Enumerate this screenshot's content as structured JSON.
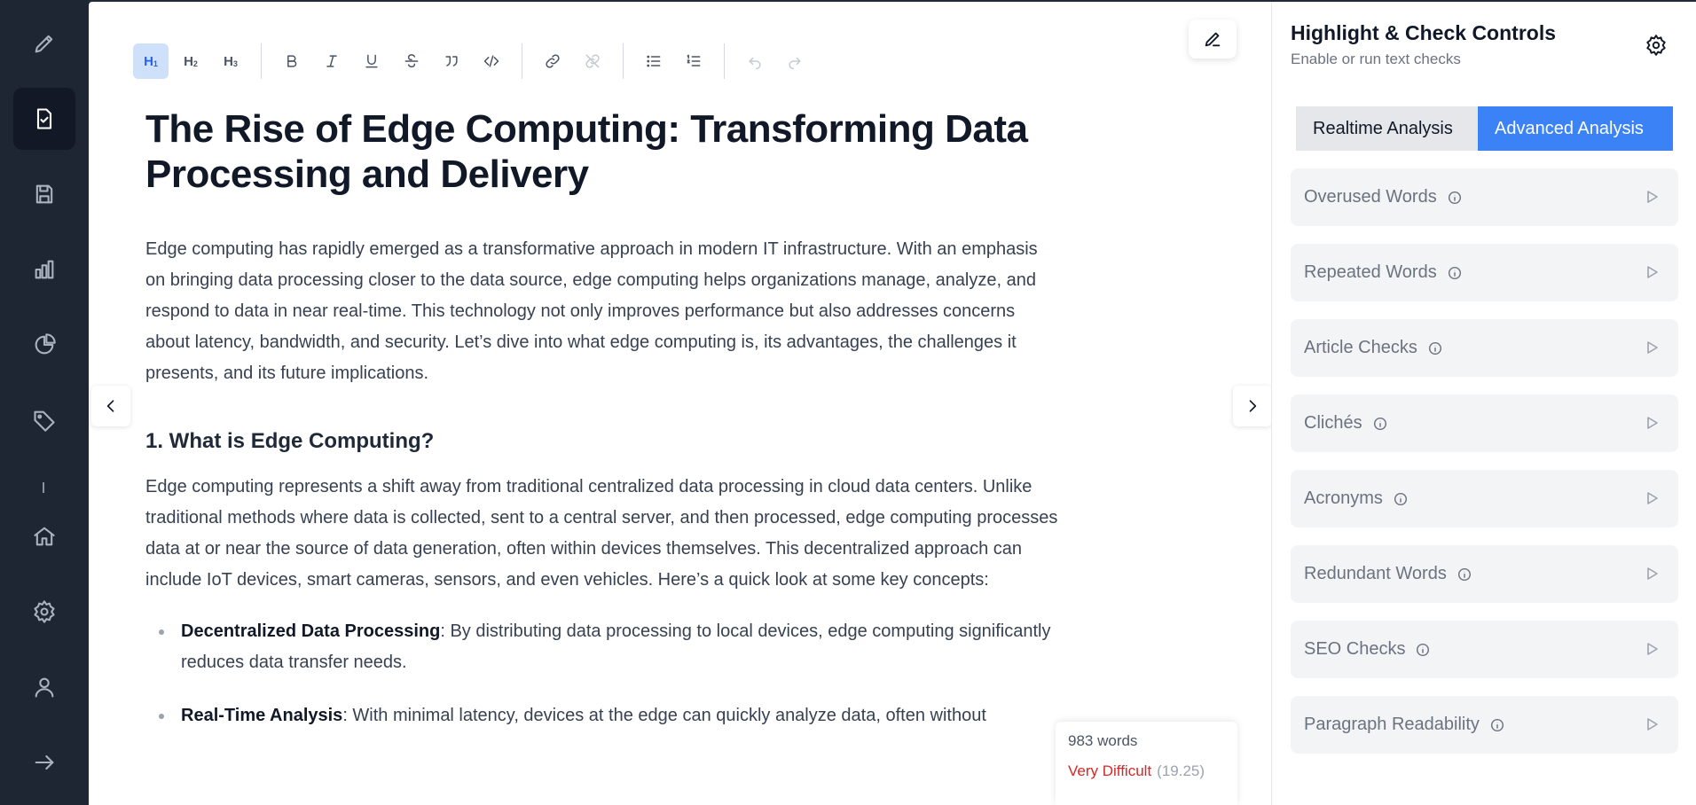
{
  "nav": {
    "items": [
      {
        "icon": "pencil-icon"
      },
      {
        "icon": "document-check-icon",
        "active": true
      },
      {
        "icon": "save-icon"
      },
      {
        "icon": "bar-chart-icon"
      },
      {
        "icon": "pie-chart-icon"
      },
      {
        "icon": "tag-icon"
      },
      {
        "icon": "home-icon"
      },
      {
        "icon": "gear-icon"
      },
      {
        "icon": "user-icon"
      },
      {
        "icon": "arrow-right-icon"
      }
    ]
  },
  "toolbar": {
    "h1": "H",
    "h1_sub": "1",
    "h2": "H",
    "h2_sub": "2",
    "h3": "H",
    "h3_sub": "3",
    "active_heading": "H1"
  },
  "document": {
    "title": "The Rise of Edge Computing: Transforming Data Processing and Delivery",
    "intro": "Edge computing has rapidly emerged as a transformative approach in modern IT infrastructure. With an emphasis on bringing data processing closer to the data source, edge computing helps organizations manage, analyze, and respond to data in near real-time. This technology not only improves performance but also addresses concerns about latency, bandwidth, and security. Let’s dive into what edge computing is, its advantages, the challenges it presents, and its future implications.",
    "section1_heading": "1. What is Edge Computing?",
    "section1_body": "Edge computing represents a shift away from traditional centralized data processing in cloud data centers. Unlike traditional methods where data is collected, sent to a central server, and then processed, edge computing processes data at or near the source of data generation, often within devices themselves. This decentralized approach can include IoT devices, smart cameras, sensors, and even vehicles. Here’s a quick look at some key concepts:",
    "bullets": [
      {
        "term": "Decentralized Data Processing",
        "text": ": By distributing data processing to local devices, edge computing significantly reduces data transfer needs."
      },
      {
        "term": "Real-Time Analysis",
        "text": ": With minimal latency, devices at the edge can quickly analyze data, often without"
      }
    ]
  },
  "stats": {
    "word_count": "983 words",
    "difficulty": "Very Difficult",
    "score": "(19.25)",
    "difficulty_color": "#dc2626"
  },
  "panel": {
    "title": "Highlight & Check Controls",
    "subtitle": "Enable or run text checks",
    "tabs": [
      {
        "label": "Realtime Analysis",
        "active": false
      },
      {
        "label": "Advanced Analysis",
        "active": true
      }
    ],
    "checks": [
      {
        "label": "Overused Words"
      },
      {
        "label": "Repeated Words"
      },
      {
        "label": "Article Checks"
      },
      {
        "label": "Clichés"
      },
      {
        "label": "Acronyms"
      },
      {
        "label": "Redundant Words"
      },
      {
        "label": "SEO Checks"
      },
      {
        "label": "Paragraph Readability"
      }
    ],
    "accent_color": "#3b82f6"
  }
}
